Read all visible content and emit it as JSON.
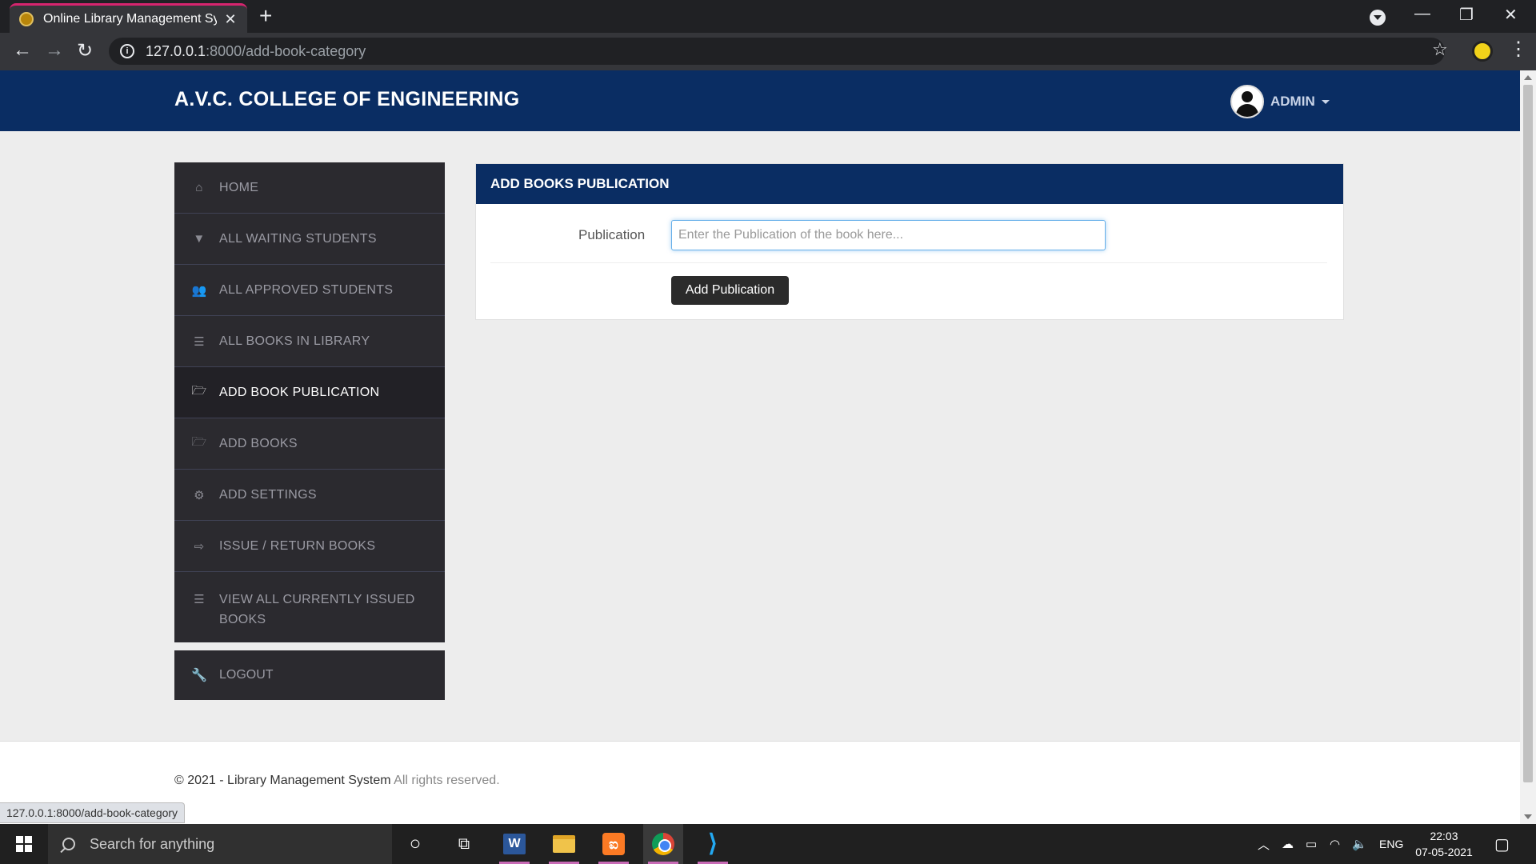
{
  "browser": {
    "tab_title": "Online Library Management Syst",
    "url_host": "127.0.0.1",
    "url_path": ":8000/add-book-category",
    "status_url": "127.0.0.1:8000/add-book-category"
  },
  "header": {
    "brand": "A.V.C. COLLEGE OF ENGINEERING",
    "user_name": "ADMIN"
  },
  "sidebar": {
    "items": [
      {
        "label": "HOME",
        "icon": "home-icon",
        "glyph": "⌂"
      },
      {
        "label": "ALL WAITING STUDENTS",
        "icon": "filter-icon",
        "glyph": "▼"
      },
      {
        "label": "ALL APPROVED STUDENTS",
        "icon": "users-icon",
        "glyph": "👥"
      },
      {
        "label": "ALL BOOKS IN LIBRARY",
        "icon": "list-icon",
        "glyph": "☰"
      },
      {
        "label": "ADD BOOK PUBLICATION",
        "icon": "folder-open-icon",
        "glyph": "🗁"
      },
      {
        "label": "ADD BOOKS",
        "icon": "folder-open-icon",
        "glyph": "🗁"
      },
      {
        "label": "ADD SETTINGS",
        "icon": "gear-icon",
        "glyph": "⚙"
      },
      {
        "label": "ISSUE / RETURN BOOKS",
        "icon": "share-icon",
        "glyph": "⇨"
      },
      {
        "label": "VIEW ALL CURRENTLY ISSUED BOOKS",
        "icon": "list-icon",
        "glyph": "☰"
      }
    ],
    "logout_label": "LOGOUT",
    "logout_glyph": "🔧"
  },
  "panel": {
    "title": "ADD BOOKS PUBLICATION",
    "field_label": "Publication",
    "field_placeholder": "Enter the Publication of the book here...",
    "field_value": "",
    "submit_label": "Add Publication"
  },
  "footer": {
    "copyright": "© 2021 - Library Management System",
    "rights": "All rights reserved."
  },
  "taskbar": {
    "search_placeholder": "Search for anything",
    "language": "ENG",
    "time": "22:03",
    "date": "07-05-2021"
  },
  "colors": {
    "header_bg": "#0a2d63",
    "sidebar_bg": "#2b2a2f",
    "active_item_bg": "#222126",
    "button_bg": "#2b2b2b"
  }
}
